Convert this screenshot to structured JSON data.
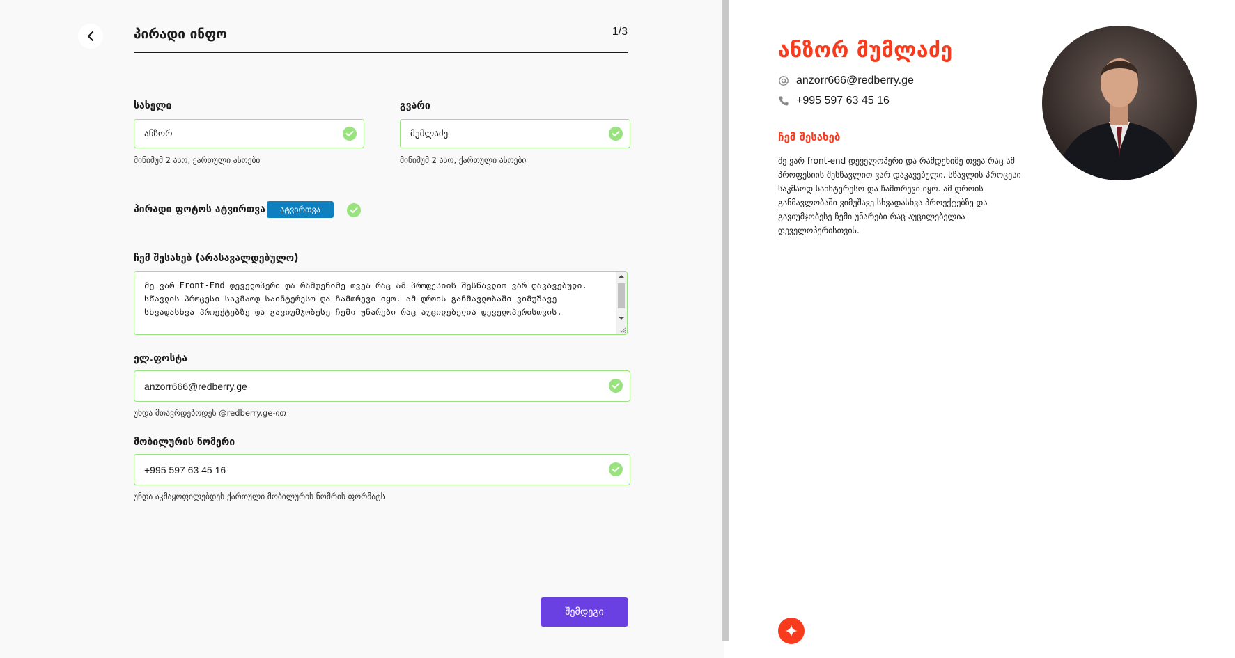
{
  "header": {
    "title": "პირადი ინფო",
    "step": "1/3"
  },
  "form": {
    "first_name": {
      "label": "სახელი",
      "value": "ანზორ",
      "hint": "მინიმუმ 2 ასო, ქართული ასოები"
    },
    "last_name": {
      "label": "გვარი",
      "value": "მუმლაძე",
      "hint": "მინიმუმ 2 ასო, ქართული ასოები"
    },
    "photo": {
      "label": "პირადი ფოტოს ატვირთვა",
      "button": "ატვირთვა"
    },
    "about": {
      "label": "ჩემ შესახებ (არასავალდებულო)",
      "value": "მე ვარ Front-End დეველოპერი და რამდენიმე თვეა რაც ამ პროფესიის შესწავლით ვარ დაკავებული. სწავლის პროცესი საკმაოდ საინტერესო და ჩამთრევი იყო. ამ დროის განმავლობაში ვიმუშავე სხვადასხვა პროექტებზე და გავიუმჯობესე ჩემი უნარები რაც აუცილებელია დეველოპერისთვის."
    },
    "email": {
      "label": "ელ.ფოსტა",
      "value": "anzorr666@redberry.ge",
      "hint": "უნდა მთავრდებოდეს @redberry.ge-ით"
    },
    "phone": {
      "label": "მობილურის ნომერი",
      "value": "+995 597 63 45 16",
      "hint": "უნდა აკმაყოფილებდეს ქართული მობილურის ნომრის ფორმატს"
    },
    "next_button": "შემდეგი"
  },
  "resume": {
    "name": "ანზორ მუმლაძე",
    "email": "anzorr666@redberry.ge",
    "phone": "+995 597 63 45 16",
    "about_heading": "ჩემ შესახებ",
    "about_text": "მე ვარ front-end დეველოპერი და რამდენიმე თვეა რაც ამ პროფესიის შესწავლით ვარ დაკავებული. სწავლის პროცესი საკმაოდ საინტერესო და ჩამთრევი იყო. ამ დროის განმავლობაში ვიმუშავე სხვადასხვა პროექტებზე და გავიუმჯობესე ჩემი უნარები რაც აუცილებელია დეველოპერისთვის."
  },
  "colors": {
    "accent_red": "#f93b1d",
    "valid_green": "#98e37e",
    "upload_blue": "#0e80bf",
    "next_purple": "#6b40e3"
  }
}
